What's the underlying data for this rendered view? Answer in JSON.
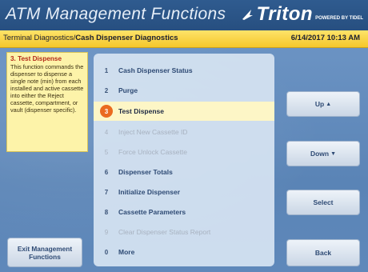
{
  "header": {
    "title": "ATM Management Functions",
    "brand": "Triton",
    "brand_tagline": "POWERED BY TIDEL"
  },
  "breadcrumb": {
    "section": "Terminal Diagnostics",
    "separator": "/",
    "current": "Cash Dispenser Diagnostics"
  },
  "datetime": "6/14/2017  10:13 AM",
  "help": {
    "title": "3. Test Dispense",
    "body": "This function commands the dispenser to dispense a single note (min) from each installed and active cassette into either the Reject cassette, compartment, or vault (dispenser specific)."
  },
  "menu": {
    "items": [
      {
        "num": "1",
        "label": "Cash Dispenser Status"
      },
      {
        "num": "2",
        "label": "Purge"
      },
      {
        "num": "3",
        "label": "Test Dispense"
      },
      {
        "num": "4",
        "label": "Inject New Cassette ID"
      },
      {
        "num": "5",
        "label": "Force Unlock Cassette"
      },
      {
        "num": "6",
        "label": "Dispenser Totals"
      },
      {
        "num": "7",
        "label": "Initialize Dispenser"
      },
      {
        "num": "8",
        "label": "Cassette Parameters"
      },
      {
        "num": "9",
        "label": "Clear Dispenser Status Report"
      },
      {
        "num": "0",
        "label": "More"
      }
    ]
  },
  "buttons": {
    "up": "Up",
    "down": "Down",
    "select": "Select",
    "back": "Back",
    "exit": "Exit Management Functions"
  },
  "colors": {
    "selected_badge": "#ea6a1f",
    "breadcrumb_bar": "#f5c72a",
    "header": "#2f5b8f"
  }
}
